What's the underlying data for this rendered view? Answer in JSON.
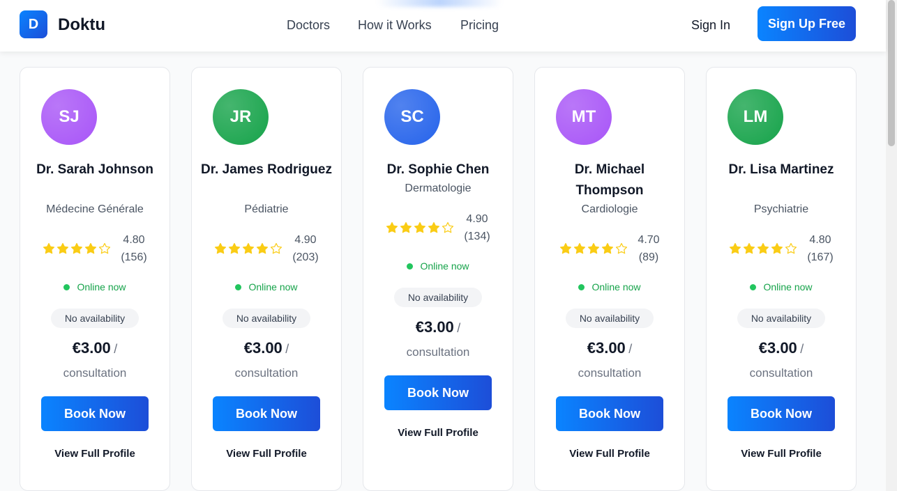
{
  "header": {
    "logo_letter": "D",
    "logo_text": "Doktu",
    "nav": [
      "Doctors",
      "How it Works",
      "Pricing"
    ],
    "sign_in": "Sign In",
    "sign_up": "Sign Up Free"
  },
  "doctors": [
    {
      "initials": "SJ",
      "name": "Dr. Sarah Johnson",
      "specialty": "Médecine Générale",
      "rating": "4.80",
      "reviews": "(156)",
      "stars": 4,
      "status": "Online now",
      "availability": "No availability",
      "price": "€3.00",
      "per": "consultation",
      "book": "Book Now",
      "profile": "View Full Profile",
      "color": "#a855f7"
    },
    {
      "initials": "JR",
      "name": "Dr. James Rodriguez",
      "specialty": "Pédiatrie",
      "rating": "4.90",
      "reviews": "(203)",
      "stars": 4,
      "status": "Online now",
      "availability": "No availability",
      "price": "€3.00",
      "per": "consultation",
      "book": "Book Now",
      "profile": "View Full Profile",
      "color": "#16a34a"
    },
    {
      "initials": "SC",
      "name": "Dr. Sophie Chen",
      "specialty": "Dermatologie",
      "rating": "4.90",
      "reviews": "(134)",
      "stars": 4,
      "status": "Online now",
      "availability": "No availability",
      "price": "€3.00",
      "per": "consultation",
      "book": "Book Now",
      "profile": "View Full Profile",
      "color": "#2563eb"
    },
    {
      "initials": "MT",
      "name": "Dr. Michael Thompson",
      "specialty": "Cardiologie",
      "rating": "4.70",
      "reviews": "(89)",
      "stars": 4,
      "status": "Online now",
      "availability": "No availability",
      "price": "€3.00",
      "per": "consultation",
      "book": "Book Now",
      "profile": "View Full Profile",
      "color": "#a855f7"
    },
    {
      "initials": "LM",
      "name": "Dr. Lisa Martinez",
      "specialty": "Psychiatrie",
      "rating": "4.80",
      "reviews": "(167)",
      "stars": 4,
      "status": "Online now",
      "availability": "No availability",
      "price": "€3.00",
      "per": "consultation",
      "book": "Book Now",
      "profile": "View Full Profile",
      "color": "#16a34a"
    }
  ],
  "colors": {
    "accent": "#0a84ff",
    "star": "#facc15",
    "online": "#22c55e"
  }
}
